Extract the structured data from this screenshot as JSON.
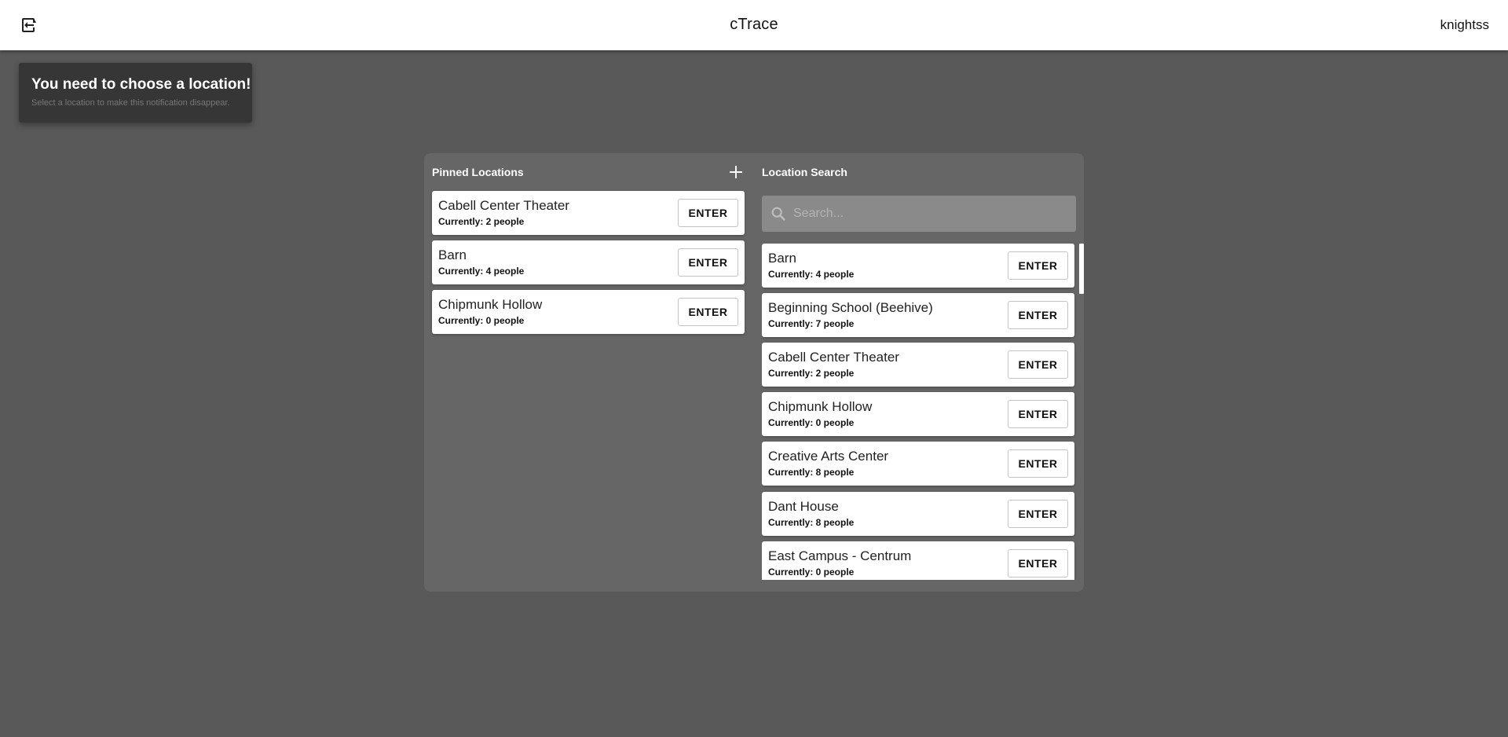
{
  "header": {
    "title": "cTrace",
    "username": "knightss",
    "logout_icon": "logout-icon"
  },
  "notification": {
    "title": "You need to choose a location!",
    "subtitle": "Select a location to make this notification disappear."
  },
  "pinned": {
    "heading": "Pinned Locations",
    "add_icon": "plus-icon",
    "items": [
      {
        "name": "Cabell Center Theater",
        "count": "Currently: 2 people",
        "button": "ENTER"
      },
      {
        "name": "Barn",
        "count": "Currently: 4 people",
        "button": "ENTER"
      },
      {
        "name": "Chipmunk Hollow",
        "count": "Currently: 0 people",
        "button": "ENTER"
      }
    ]
  },
  "search": {
    "heading": "Location Search",
    "placeholder": "Search...",
    "icon": "search-icon",
    "results": [
      {
        "name": "Barn",
        "count": "Currently: 4 people",
        "button": "ENTER"
      },
      {
        "name": "Beginning School (Beehive)",
        "count": "Currently: 7 people",
        "button": "ENTER"
      },
      {
        "name": "Cabell Center Theater",
        "count": "Currently: 2 people",
        "button": "ENTER"
      },
      {
        "name": "Chipmunk Hollow",
        "count": "Currently: 0 people",
        "button": "ENTER"
      },
      {
        "name": "Creative Arts Center",
        "count": "Currently: 8 people",
        "button": "ENTER"
      },
      {
        "name": "Dant House",
        "count": "Currently: 8 people",
        "button": "ENTER"
      },
      {
        "name": "East Campus - Centrum",
        "count": "Currently: 0 people",
        "button": "ENTER"
      }
    ]
  },
  "colors": {
    "background": "#595959",
    "panel": "#666666",
    "toast": "#363636",
    "search_field": "#8a8a8a"
  }
}
